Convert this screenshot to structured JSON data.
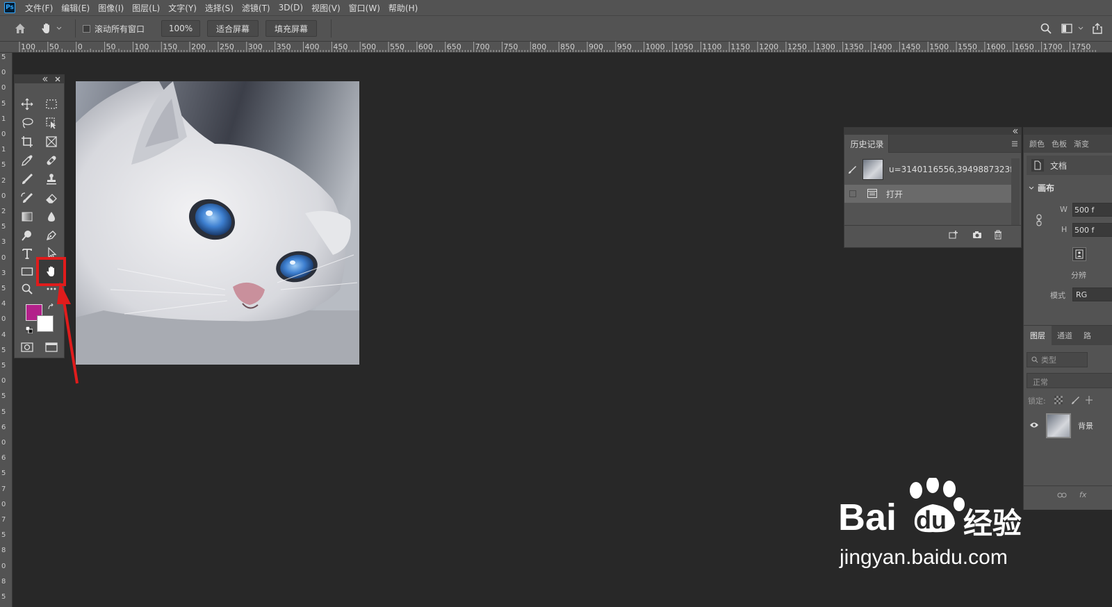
{
  "menu": {
    "logo": "Ps",
    "items": [
      "文件(F)",
      "编辑(E)",
      "图像(I)",
      "图层(L)",
      "文字(Y)",
      "选择(S)",
      "滤镜(T)",
      "3D(D)",
      "视图(V)",
      "窗口(W)",
      "帮助(H)"
    ]
  },
  "options": {
    "scroll_all": "滚动所有窗口",
    "zoom": "100%",
    "fit_screen": "适合屏幕",
    "fill_screen": "填充屏幕"
  },
  "ruler": {
    "top": [
      "100",
      "50",
      "0",
      "50",
      "100",
      "150",
      "200",
      "250",
      "300",
      "350",
      "400",
      "450",
      "500",
      "550",
      "600",
      "650",
      "700",
      "750",
      "800",
      "850",
      "900",
      "950",
      "1000",
      "1050",
      "1100",
      "1150",
      "1200",
      "1250",
      "1300",
      "1350",
      "1400",
      "1450",
      "1500",
      "1550",
      "1600",
      "1650",
      "1700",
      "1750"
    ],
    "left": [
      "5",
      "0",
      "0",
      "5",
      "1",
      "0",
      "1",
      "5",
      "2",
      "0",
      "2",
      "5",
      "3",
      "0",
      "3",
      "5",
      "4",
      "0",
      "4",
      "5",
      "5",
      "0",
      "5",
      "5",
      "6",
      "0",
      "6",
      "5",
      "7",
      "0",
      "7",
      "5",
      "8",
      "0",
      "8",
      "5"
    ]
  },
  "colors": {
    "foreground": "#b3218a",
    "background": "#ffffff",
    "highlight": "#e01c1c"
  },
  "history": {
    "tab": "历史记录",
    "snapshot": "u=3140116556,3949887323f...",
    "step": "打开"
  },
  "properties": {
    "tabs": [
      "颜色",
      "色板",
      "渐变"
    ],
    "doc_label": "文档",
    "canvas_label": "画布",
    "w_label": "W",
    "w_value": "500 f",
    "h_label": "H",
    "h_value": "500 f",
    "resolution_label": "分辨",
    "mode_label": "模式",
    "mode_value": "RG"
  },
  "layers": {
    "tabs": [
      "图层",
      "通道",
      "路"
    ],
    "filter_placeholder": "类型",
    "blend_mode": "正常",
    "lock_label": "锁定:",
    "layer_name": "背景",
    "fx": "fx"
  },
  "watermark": {
    "brand": "Bai",
    "brand2": "du",
    "product": "经验",
    "url": "jingyan.baidu.com"
  }
}
